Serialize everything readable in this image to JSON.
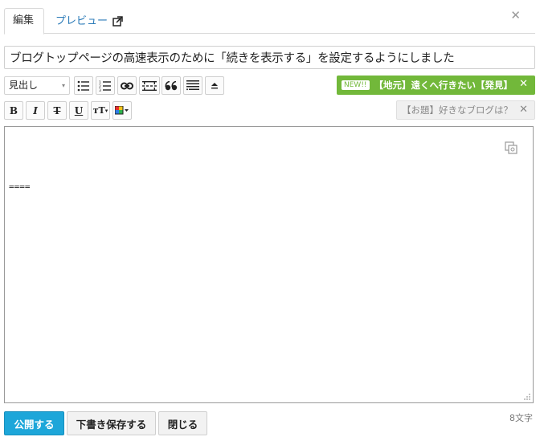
{
  "tabs": {
    "edit": "編集",
    "preview": "プレビュー"
  },
  "title_value": "ブログトップページの高速表示のために「続きを表示する」を設定するようにしました",
  "toolbar": {
    "heading_select": "見出し",
    "icons_row1": [
      "bullet-list-icon",
      "numbered-list-icon",
      "link-icon",
      "more-separator-icon",
      "quote-icon",
      "table-of-contents-icon",
      "upload-icon"
    ],
    "bold_label": "B",
    "italic_label": "I",
    "strike_label": "T",
    "underline_label": "U",
    "font_size_label": "тT"
  },
  "topics": {
    "new_label": "NEW!!",
    "green_topic": "【地元】遠くへ行きたい【発見】",
    "gray_topic": "【お題】好きなブログは？",
    "dismiss_label": "✕"
  },
  "editor": {
    "content": "===="
  },
  "actions": {
    "publish": "公開する",
    "save_draft": "下書き保存する",
    "close": "閉じる"
  },
  "char_count": "8文字",
  "colors": {
    "accent_blue": "#1da6d9",
    "topic_green": "#72b83a",
    "link_blue": "#2a7ab8"
  }
}
